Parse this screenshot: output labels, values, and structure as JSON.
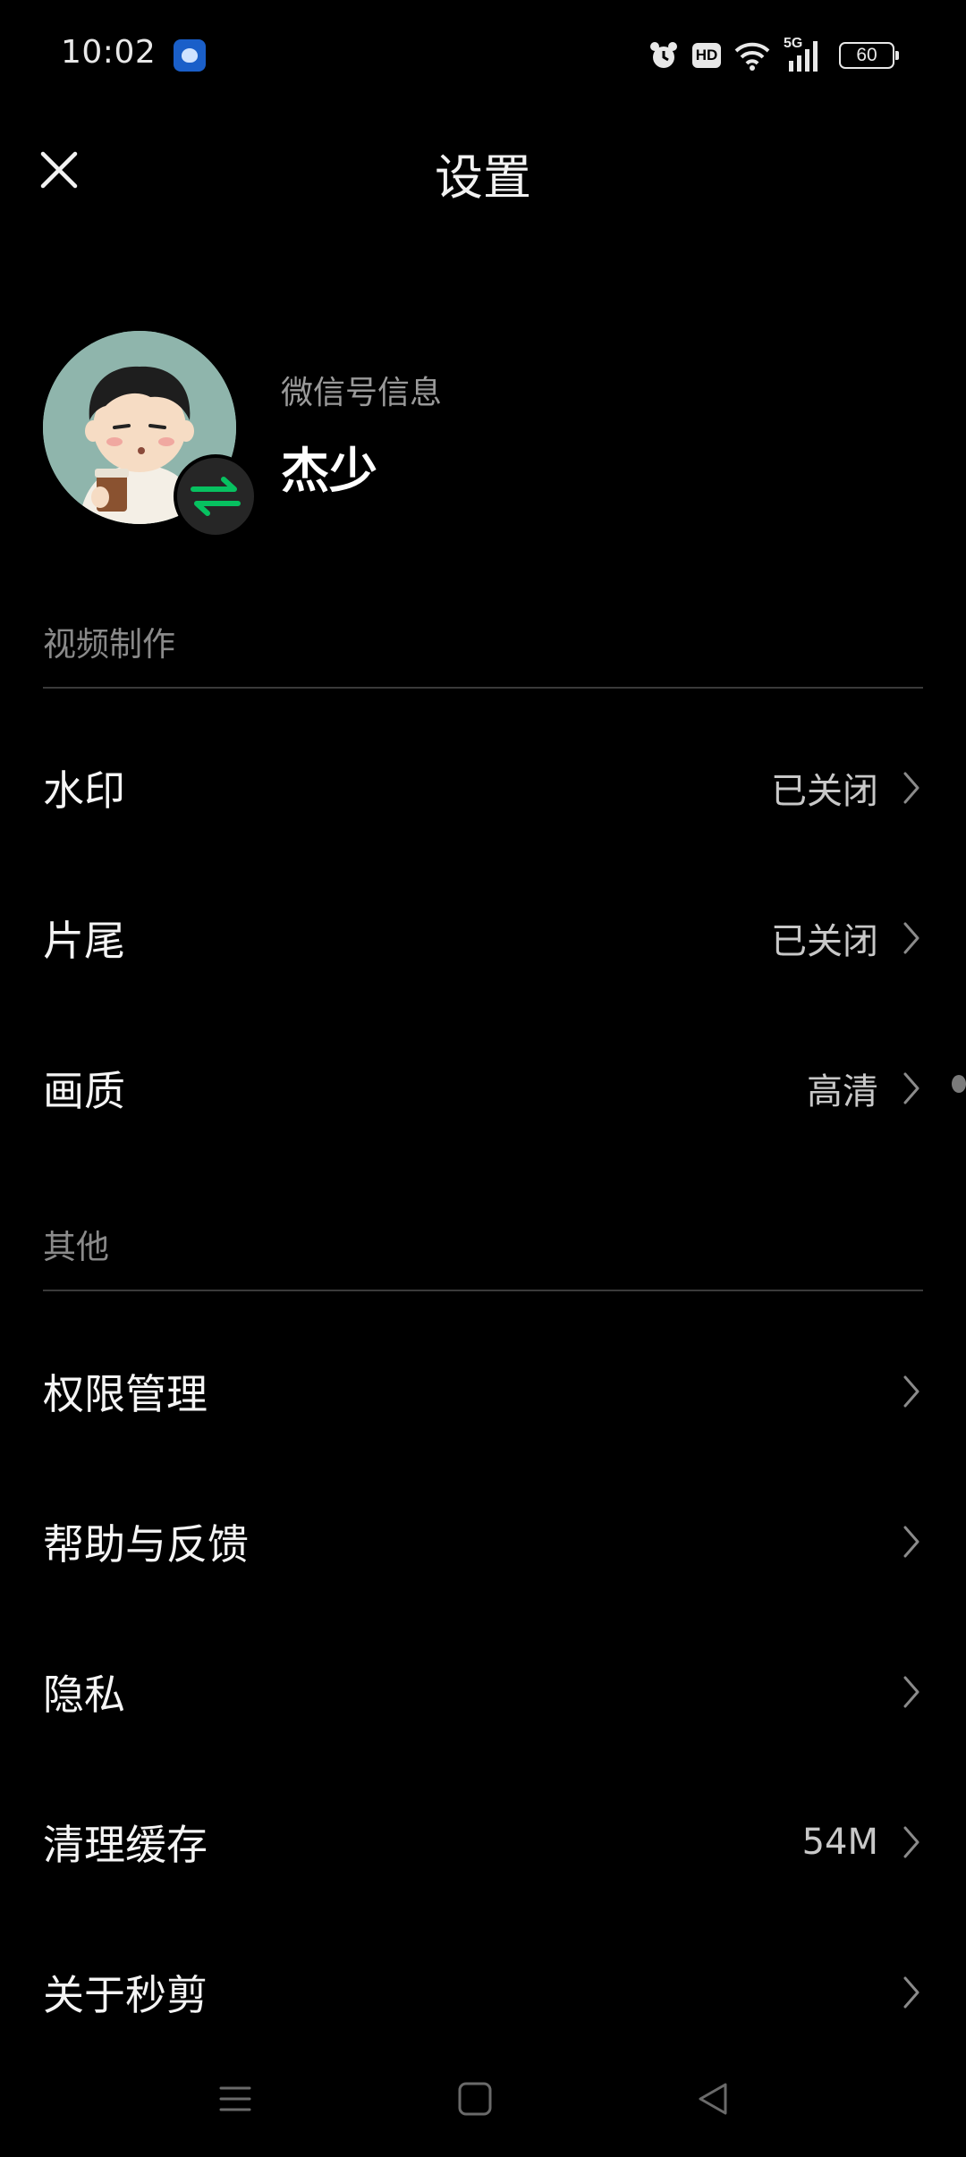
{
  "status_bar": {
    "time": "10:02",
    "hd_label": "HD",
    "network_label": "5G",
    "battery": "60"
  },
  "header": {
    "title": "设置"
  },
  "profile": {
    "subtitle": "微信号信息",
    "name": "杰少"
  },
  "sections": {
    "video": {
      "header": "视频制作",
      "items": [
        {
          "label": "水印",
          "value": "已关闭"
        },
        {
          "label": "片尾",
          "value": "已关闭"
        },
        {
          "label": "画质",
          "value": "高清"
        }
      ]
    },
    "other": {
      "header": "其他",
      "items": [
        {
          "label": "权限管理",
          "value": ""
        },
        {
          "label": "帮助与反馈",
          "value": ""
        },
        {
          "label": "隐私",
          "value": ""
        },
        {
          "label": "清理缓存",
          "value": "54M"
        },
        {
          "label": "关于秒剪",
          "value": ""
        }
      ]
    }
  },
  "colors": {
    "background": "#000000",
    "accent_green": "#07c160",
    "secondary_text": "#8a8a8a"
  },
  "icons": {
    "close": "close-icon",
    "switch_account": "switch-arrows-icon",
    "chevron": "chevron-right-icon",
    "nav_menu": "menu-icon",
    "nav_home": "square-home-icon",
    "nav_back": "triangle-back-icon"
  }
}
